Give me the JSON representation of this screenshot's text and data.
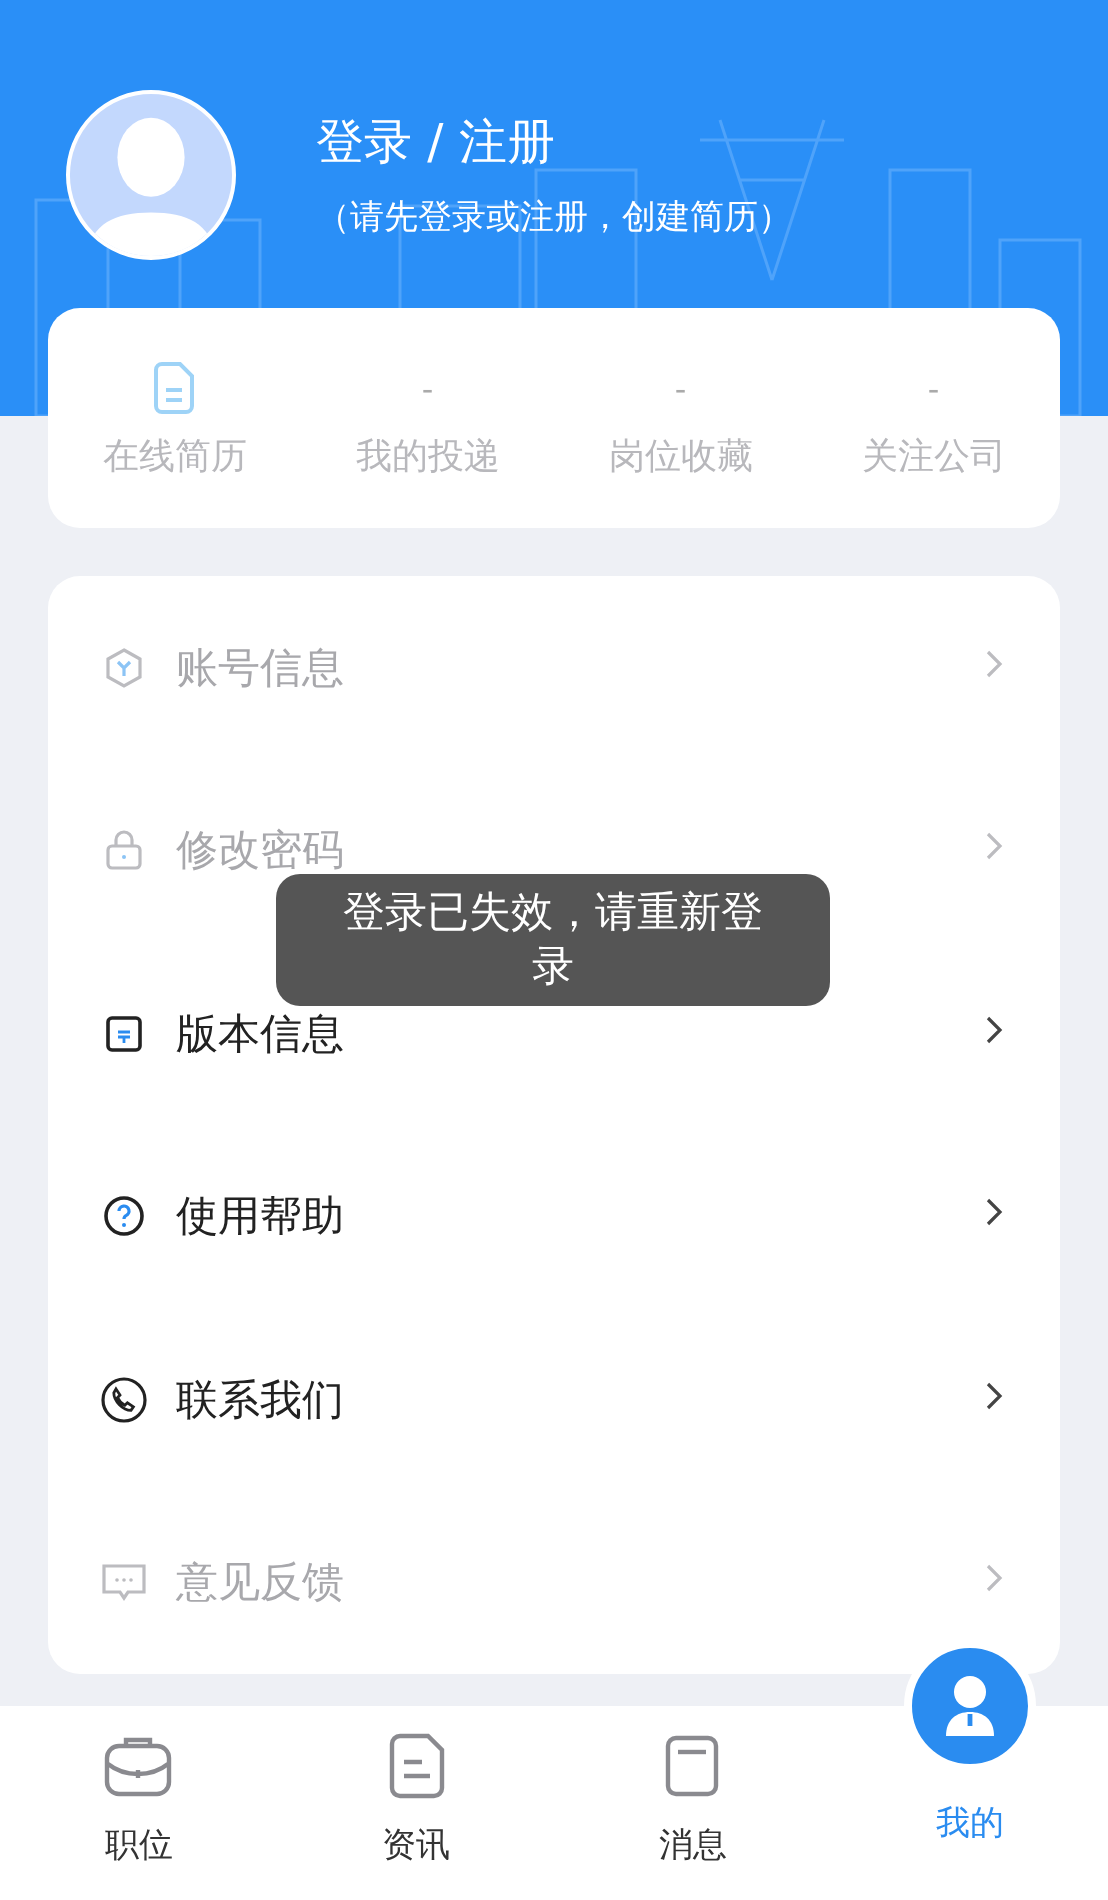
{
  "header": {
    "title": "登录 / 注册",
    "subtitle": "（请先登录或注册，创建简历）"
  },
  "stats": [
    {
      "kind": "icon",
      "label": "在线简历"
    },
    {
      "kind": "count",
      "value": "-",
      "label": "我的投递"
    },
    {
      "kind": "count",
      "value": "-",
      "label": "岗位收藏"
    },
    {
      "kind": "count",
      "value": "-",
      "label": "关注公司"
    }
  ],
  "menu": [
    {
      "label": "账号信息",
      "disabled": true
    },
    {
      "label": "修改密码",
      "disabled": true
    },
    {
      "label": "版本信息",
      "disabled": false
    },
    {
      "label": "使用帮助",
      "disabled": false
    },
    {
      "label": "联系我们",
      "disabled": false
    },
    {
      "label": "意见反馈",
      "disabled": true
    }
  ],
  "toast": "登录已失效，请重新登录",
  "tabs": [
    {
      "label": "职位",
      "selected": false
    },
    {
      "label": "资讯",
      "selected": false
    },
    {
      "label": "消息",
      "selected": false
    },
    {
      "label": "我的",
      "selected": true
    }
  ]
}
